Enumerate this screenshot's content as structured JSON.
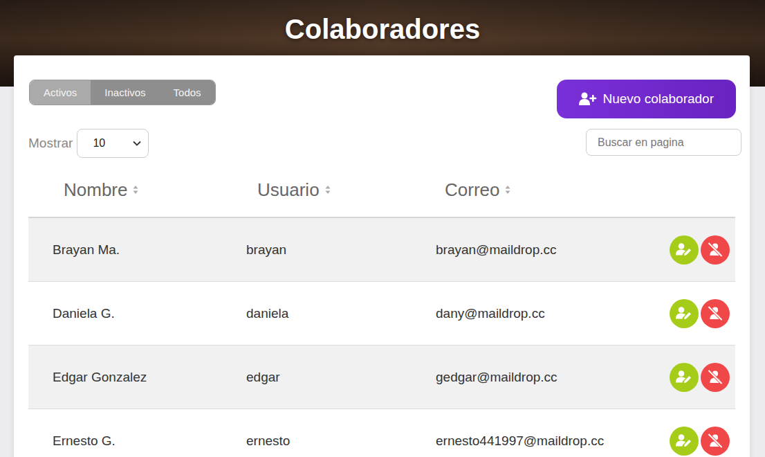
{
  "header": {
    "title": "Colaboradores"
  },
  "filter_tabs": [
    {
      "label": "Activos",
      "selected": true
    },
    {
      "label": "Inactivos",
      "selected": false
    },
    {
      "label": "Todos",
      "selected": false
    }
  ],
  "new_button": {
    "label": "Nuevo colaborador"
  },
  "page_size": {
    "label": "Mostrar",
    "value": "10"
  },
  "search": {
    "placeholder": "Buscar en pagina"
  },
  "table": {
    "columns": [
      "Nombre",
      "Usuario",
      "Correo"
    ],
    "rows": [
      {
        "name": "Brayan Ma.",
        "user": "brayan",
        "email": "brayan@maildrop.cc"
      },
      {
        "name": "Daniela G.",
        "user": "daniela",
        "email": "dany@maildrop.cc"
      },
      {
        "name": "Edgar Gonzalez",
        "user": "edgar",
        "email": "gedgar@maildrop.cc"
      },
      {
        "name": "Ernesto G.",
        "user": "ernesto",
        "email": "ernesto441997@maildrop.cc"
      }
    ]
  }
}
